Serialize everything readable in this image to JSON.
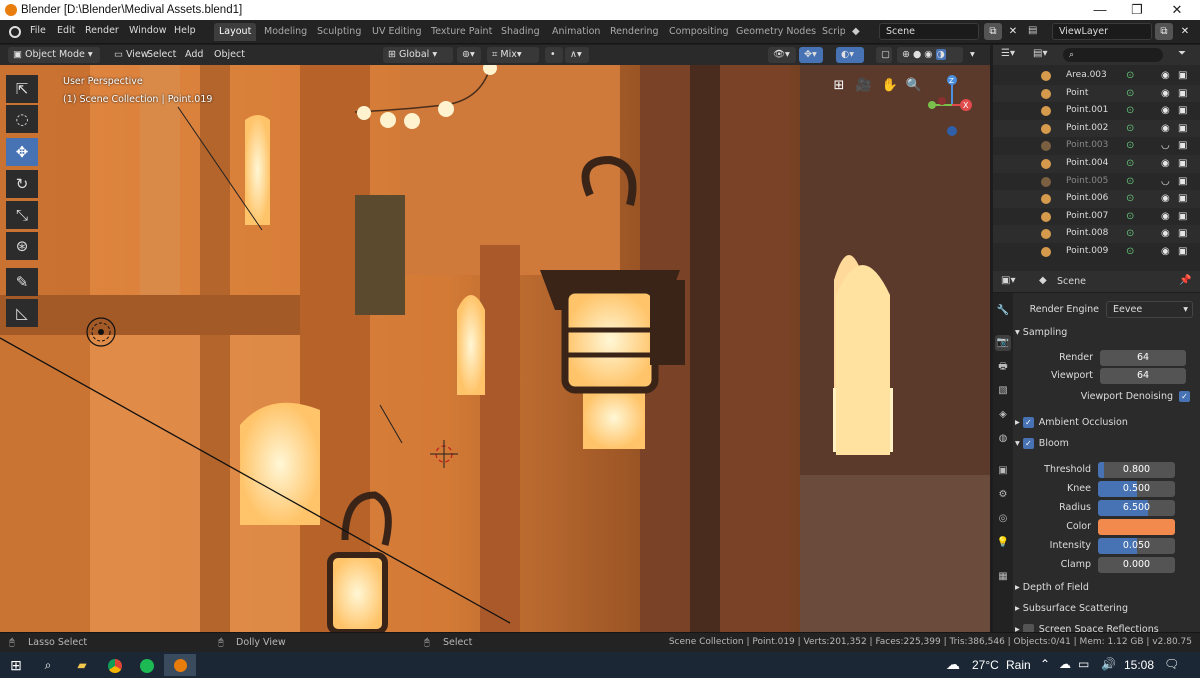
{
  "window": {
    "title": "Blender [D:\\Blender\\Medival Assets.blend1]",
    "minimize": "—",
    "maximize": "❐",
    "close": "✕"
  },
  "menus": [
    "File",
    "Edit",
    "Render",
    "Window",
    "Help"
  ],
  "workspaces": {
    "active": "Layout",
    "tabs": [
      "Modeling",
      "Sculpting",
      "UV Editing",
      "Texture Paint",
      "Shading",
      "Animation",
      "Rendering",
      "Compositing",
      "Geometry Nodes",
      "Script"
    ]
  },
  "scene": {
    "label": "Scene",
    "viewlayer": "ViewLayer"
  },
  "viewport_header": {
    "mode": "Object Mode",
    "view": "View",
    "select": "Select",
    "add": "Add",
    "object": "Object",
    "orientation": "Global",
    "mix": "Mix"
  },
  "viewport": {
    "perspective": "User Perspective",
    "collection": "(1) Scene Collection | Point.019",
    "axis_x": "X",
    "axis_z": "Z"
  },
  "outliner": {
    "rows": [
      {
        "name": "Area.003",
        "dim": false
      },
      {
        "name": "Point",
        "dim": false
      },
      {
        "name": "Point.001",
        "dim": false
      },
      {
        "name": "Point.002",
        "dim": false
      },
      {
        "name": "Point.003",
        "dim": true
      },
      {
        "name": "Point.004",
        "dim": false
      },
      {
        "name": "Point.005",
        "dim": true
      },
      {
        "name": "Point.006",
        "dim": false
      },
      {
        "name": "Point.007",
        "dim": false
      },
      {
        "name": "Point.008",
        "dim": false
      },
      {
        "name": "Point.009",
        "dim": false
      }
    ]
  },
  "properties": {
    "context": "Scene",
    "render_engine_label": "Render Engine",
    "render_engine": "Eevee",
    "sampling": {
      "title": "Sampling",
      "render_label": "Render",
      "render": "64",
      "viewport_label": "Viewport",
      "viewport": "64",
      "denoise": "Viewport Denoising"
    },
    "ao": "Ambient Occlusion",
    "bloom": {
      "title": "Bloom",
      "fields": [
        {
          "label": "Threshold",
          "value": "0.800",
          "fill": 0.08
        },
        {
          "label": "Knee",
          "value": "0.500",
          "fill": 0.5
        },
        {
          "label": "Radius",
          "value": "6.500",
          "fill": 0.65
        },
        {
          "label": "Intensity",
          "value": "0.050",
          "fill": 0.5
        },
        {
          "label": "Clamp",
          "value": "0.000",
          "fill": 0
        }
      ],
      "color_label": "Color",
      "color": "#f28a4d"
    },
    "dof": "Depth of Field",
    "sss": "Subsurface Scattering",
    "ssr": "Screen Space Reflections"
  },
  "statusbar": {
    "lasso": "Lasso Select",
    "dolly": "Dolly View",
    "select": "Select",
    "stats": "Scene Collection | Point.019 | Verts:201,352 | Faces:225,399 | Tris:386,546 | Objects:0/41 | Mem: 1.12 GB | v2.80.75"
  },
  "taskbar": {
    "temp": "27°C",
    "weather": "Rain",
    "time": "15:08"
  },
  "colors": {
    "accent": "#4772b3",
    "blender_orange": "#e87d0d"
  }
}
